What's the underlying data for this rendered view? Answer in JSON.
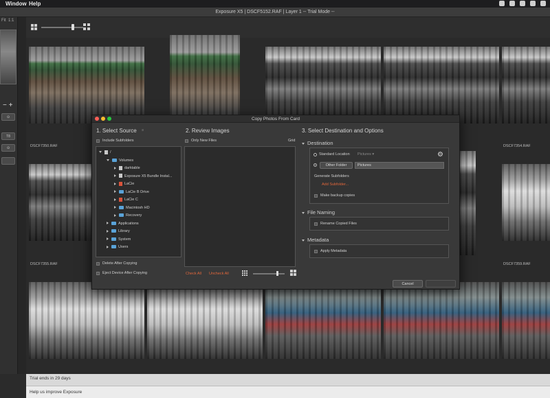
{
  "menubar": {
    "window": "Window",
    "help": "Help"
  },
  "titlebar": {
    "title": "Exposure X5 | DSCF5152.RAF | Layer 1 -- Trial Mode --"
  },
  "leftpanel": {
    "fit": "Fit",
    "one_to_one": "1:1",
    "plusminus": "− +",
    "btn1": "⊙",
    "btn2": "T8",
    "btn3": "⊙"
  },
  "filmstrip": {
    "row1_labels": [
      "DSCF7350.RAF",
      "DSCF7354.RAF"
    ],
    "row2_labels": [
      "DSCF7355.RAF",
      "DSCF7359.RAF"
    ]
  },
  "status": {
    "trial": "Trial ends in 29 days",
    "improve": "Help us improve Exposure"
  },
  "dialog": {
    "title": "Copy Photos From Card",
    "source": {
      "heading": "1. Select Source",
      "include_subfolders": "Include Subfolders",
      "tree": [
        {
          "label": "/",
          "indent": 0,
          "open": true,
          "icon": "drive"
        },
        {
          "label": "Volumes",
          "indent": 1,
          "open": true,
          "icon": "folder"
        },
        {
          "label": "darktable",
          "indent": 2,
          "open": false,
          "icon": "drive"
        },
        {
          "label": "Exposure X5 Bundle Instal...",
          "indent": 2,
          "open": false,
          "icon": "drive"
        },
        {
          "label": "LaCie",
          "indent": 2,
          "open": false,
          "icon": "drive-red"
        },
        {
          "label": "LaCie B Drive",
          "indent": 2,
          "open": false,
          "icon": "folder"
        },
        {
          "label": "LaCie C",
          "indent": 2,
          "open": false,
          "icon": "drive-red"
        },
        {
          "label": "Macintosh HD",
          "indent": 2,
          "open": false,
          "icon": "folder"
        },
        {
          "label": "Recovery",
          "indent": 2,
          "open": false,
          "icon": "folder"
        },
        {
          "label": "Applications",
          "indent": 1,
          "open": false,
          "icon": "folder"
        },
        {
          "label": "Library",
          "indent": 1,
          "open": false,
          "icon": "folder"
        },
        {
          "label": "System",
          "indent": 1,
          "open": false,
          "icon": "folder"
        },
        {
          "label": "Users",
          "indent": 1,
          "open": false,
          "icon": "folder"
        }
      ],
      "delete_after": "Delete After Copying",
      "eject_after": "Eject Device After Copying"
    },
    "review": {
      "heading": "2. Review Images",
      "only_new": "Only New Files",
      "grid": "Grid",
      "check_all": "Check All",
      "uncheck_all": "Uncheck All"
    },
    "destination": {
      "heading": "3. Select Destination and Options",
      "section": "Destination",
      "standard_location": "Standard Location",
      "standard_value": "Pictures ▾",
      "other_folder": "Other Folder",
      "other_value": "Pictures",
      "generate_subfolders": "Generate Subfolders",
      "add_subfolder": "Add Subfolder...",
      "backup": "Make backup copies"
    },
    "naming": {
      "section": "File Naming",
      "rename": "Rename Copied Files"
    },
    "metadata": {
      "section": "Metadata",
      "apply": "Apply Metadata"
    },
    "buttons": {
      "cancel": "Cancel",
      "ok": ""
    }
  }
}
